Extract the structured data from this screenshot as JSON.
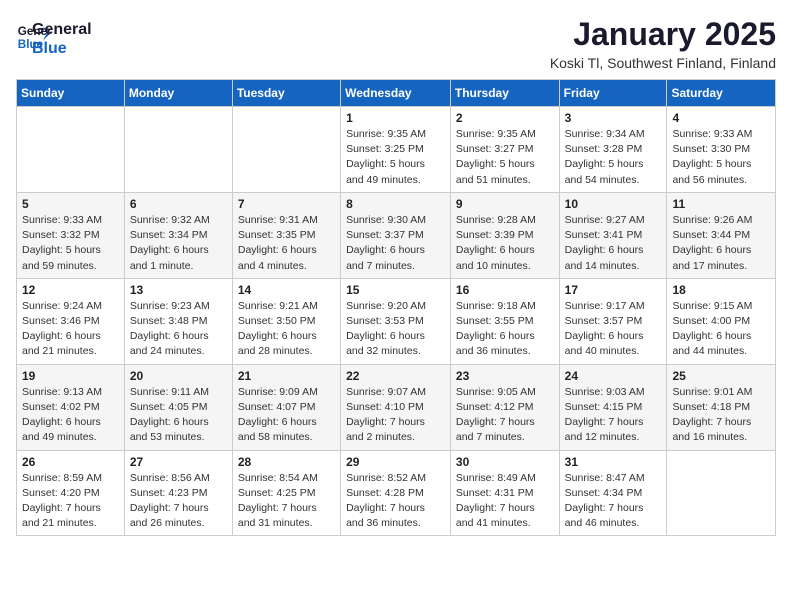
{
  "logo": {
    "line1": "General",
    "line2": "Blue"
  },
  "title": "January 2025",
  "location": "Koski Tl, Southwest Finland, Finland",
  "weekdays": [
    "Sunday",
    "Monday",
    "Tuesday",
    "Wednesday",
    "Thursday",
    "Friday",
    "Saturday"
  ],
  "weeks": [
    [
      {
        "day": "",
        "info": ""
      },
      {
        "day": "",
        "info": ""
      },
      {
        "day": "",
        "info": ""
      },
      {
        "day": "1",
        "info": "Sunrise: 9:35 AM\nSunset: 3:25 PM\nDaylight: 5 hours\nand 49 minutes."
      },
      {
        "day": "2",
        "info": "Sunrise: 9:35 AM\nSunset: 3:27 PM\nDaylight: 5 hours\nand 51 minutes."
      },
      {
        "day": "3",
        "info": "Sunrise: 9:34 AM\nSunset: 3:28 PM\nDaylight: 5 hours\nand 54 minutes."
      },
      {
        "day": "4",
        "info": "Sunrise: 9:33 AM\nSunset: 3:30 PM\nDaylight: 5 hours\nand 56 minutes."
      }
    ],
    [
      {
        "day": "5",
        "info": "Sunrise: 9:33 AM\nSunset: 3:32 PM\nDaylight: 5 hours\nand 59 minutes."
      },
      {
        "day": "6",
        "info": "Sunrise: 9:32 AM\nSunset: 3:34 PM\nDaylight: 6 hours\nand 1 minute."
      },
      {
        "day": "7",
        "info": "Sunrise: 9:31 AM\nSunset: 3:35 PM\nDaylight: 6 hours\nand 4 minutes."
      },
      {
        "day": "8",
        "info": "Sunrise: 9:30 AM\nSunset: 3:37 PM\nDaylight: 6 hours\nand 7 minutes."
      },
      {
        "day": "9",
        "info": "Sunrise: 9:28 AM\nSunset: 3:39 PM\nDaylight: 6 hours\nand 10 minutes."
      },
      {
        "day": "10",
        "info": "Sunrise: 9:27 AM\nSunset: 3:41 PM\nDaylight: 6 hours\nand 14 minutes."
      },
      {
        "day": "11",
        "info": "Sunrise: 9:26 AM\nSunset: 3:44 PM\nDaylight: 6 hours\nand 17 minutes."
      }
    ],
    [
      {
        "day": "12",
        "info": "Sunrise: 9:24 AM\nSunset: 3:46 PM\nDaylight: 6 hours\nand 21 minutes."
      },
      {
        "day": "13",
        "info": "Sunrise: 9:23 AM\nSunset: 3:48 PM\nDaylight: 6 hours\nand 24 minutes."
      },
      {
        "day": "14",
        "info": "Sunrise: 9:21 AM\nSunset: 3:50 PM\nDaylight: 6 hours\nand 28 minutes."
      },
      {
        "day": "15",
        "info": "Sunrise: 9:20 AM\nSunset: 3:53 PM\nDaylight: 6 hours\nand 32 minutes."
      },
      {
        "day": "16",
        "info": "Sunrise: 9:18 AM\nSunset: 3:55 PM\nDaylight: 6 hours\nand 36 minutes."
      },
      {
        "day": "17",
        "info": "Sunrise: 9:17 AM\nSunset: 3:57 PM\nDaylight: 6 hours\nand 40 minutes."
      },
      {
        "day": "18",
        "info": "Sunrise: 9:15 AM\nSunset: 4:00 PM\nDaylight: 6 hours\nand 44 minutes."
      }
    ],
    [
      {
        "day": "19",
        "info": "Sunrise: 9:13 AM\nSunset: 4:02 PM\nDaylight: 6 hours\nand 49 minutes."
      },
      {
        "day": "20",
        "info": "Sunrise: 9:11 AM\nSunset: 4:05 PM\nDaylight: 6 hours\nand 53 minutes."
      },
      {
        "day": "21",
        "info": "Sunrise: 9:09 AM\nSunset: 4:07 PM\nDaylight: 6 hours\nand 58 minutes."
      },
      {
        "day": "22",
        "info": "Sunrise: 9:07 AM\nSunset: 4:10 PM\nDaylight: 7 hours\nand 2 minutes."
      },
      {
        "day": "23",
        "info": "Sunrise: 9:05 AM\nSunset: 4:12 PM\nDaylight: 7 hours\nand 7 minutes."
      },
      {
        "day": "24",
        "info": "Sunrise: 9:03 AM\nSunset: 4:15 PM\nDaylight: 7 hours\nand 12 minutes."
      },
      {
        "day": "25",
        "info": "Sunrise: 9:01 AM\nSunset: 4:18 PM\nDaylight: 7 hours\nand 16 minutes."
      }
    ],
    [
      {
        "day": "26",
        "info": "Sunrise: 8:59 AM\nSunset: 4:20 PM\nDaylight: 7 hours\nand 21 minutes."
      },
      {
        "day": "27",
        "info": "Sunrise: 8:56 AM\nSunset: 4:23 PM\nDaylight: 7 hours\nand 26 minutes."
      },
      {
        "day": "28",
        "info": "Sunrise: 8:54 AM\nSunset: 4:25 PM\nDaylight: 7 hours\nand 31 minutes."
      },
      {
        "day": "29",
        "info": "Sunrise: 8:52 AM\nSunset: 4:28 PM\nDaylight: 7 hours\nand 36 minutes."
      },
      {
        "day": "30",
        "info": "Sunrise: 8:49 AM\nSunset: 4:31 PM\nDaylight: 7 hours\nand 41 minutes."
      },
      {
        "day": "31",
        "info": "Sunrise: 8:47 AM\nSunset: 4:34 PM\nDaylight: 7 hours\nand 46 minutes."
      },
      {
        "day": "",
        "info": ""
      }
    ]
  ]
}
